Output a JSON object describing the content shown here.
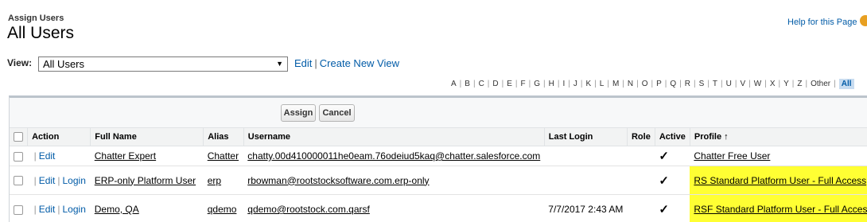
{
  "header": {
    "subtitle": "Assign Users",
    "title": "All Users",
    "help_link": "Help for this Page"
  },
  "view": {
    "label": "View:",
    "selected": "All Users",
    "edit_link": "Edit",
    "separator": "|",
    "create_link": "Create New View"
  },
  "alphabet": {
    "letters": [
      "A",
      "B",
      "C",
      "D",
      "E",
      "F",
      "G",
      "H",
      "I",
      "J",
      "K",
      "L",
      "M",
      "N",
      "O",
      "P",
      "Q",
      "R",
      "S",
      "T",
      "U",
      "V",
      "W",
      "X",
      "Y",
      "Z",
      "Other",
      "All"
    ],
    "active": "All"
  },
  "buttons": {
    "assign": "Assign",
    "cancel": "Cancel"
  },
  "table": {
    "columns": {
      "action": "Action",
      "full_name": "Full Name",
      "alias": "Alias",
      "username": "Username",
      "last_login": "Last Login",
      "role": "Role",
      "active": "Active",
      "profile": "Profile ↑"
    },
    "rows": [
      {
        "edit": "Edit",
        "login": "",
        "full_name": "Chatter Expert",
        "alias": "Chatter",
        "username": "chatty.00d410000011he0eam.76odeiud5kaq@chatter.salesforce.com",
        "last_login": "",
        "role": "",
        "active": "✓",
        "profile": "Chatter Free User"
      },
      {
        "edit": "Edit",
        "login": "Login",
        "full_name": "ERP-only Platform User",
        "alias": "erp",
        "username": "rbowman@rootstocksoftware.com.erp-only",
        "last_login": "",
        "role": "",
        "active": "✓",
        "profile": "RS Standard Platform User - Full Access"
      },
      {
        "edit": "Edit",
        "login": "Login",
        "full_name": "Demo, QA",
        "alias": "qdemo",
        "username": "qdemo@rootstock.com.qarsf",
        "last_login": "7/7/2017 2:43 AM",
        "role": "",
        "active": "✓",
        "profile": "RSF Standard Platform User - Full Access"
      }
    ]
  },
  "colors": {
    "link": "#015ba7",
    "highlight": "#ffff33",
    "header_bg": "#f2f3f3"
  }
}
